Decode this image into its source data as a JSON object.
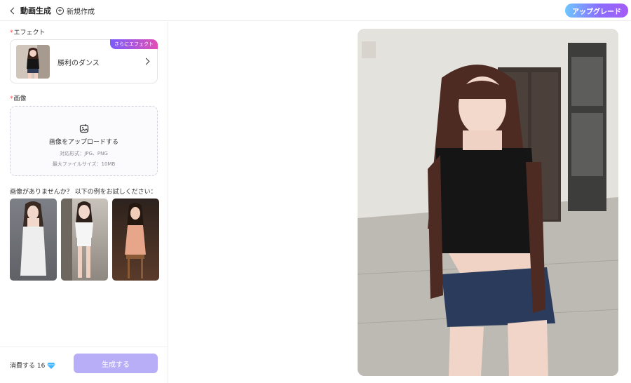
{
  "header": {
    "back_label": "動画生成",
    "new_label": "新規作成",
    "upgrade_label": "アップグレード"
  },
  "effect": {
    "section_label": "エフェクト",
    "name": "勝利のダンス",
    "badge": "さらにエフェクト"
  },
  "image": {
    "section_label": "画像",
    "upload_title": "画像をアップロードする",
    "formats": "対応形式：JPG、PNG",
    "max_size": "最大ファイルサイズ：10MB"
  },
  "examples": {
    "label": "画像がありませんか？ 以下の例をお試しください："
  },
  "footer": {
    "cost_label": "消費する 16",
    "generate_label": "生成する"
  },
  "colors": {
    "accent": "#8b6cff",
    "generate_disabled": "#b8adf7",
    "required": "#ff4d4f",
    "diamond": "#3fb6ff"
  }
}
